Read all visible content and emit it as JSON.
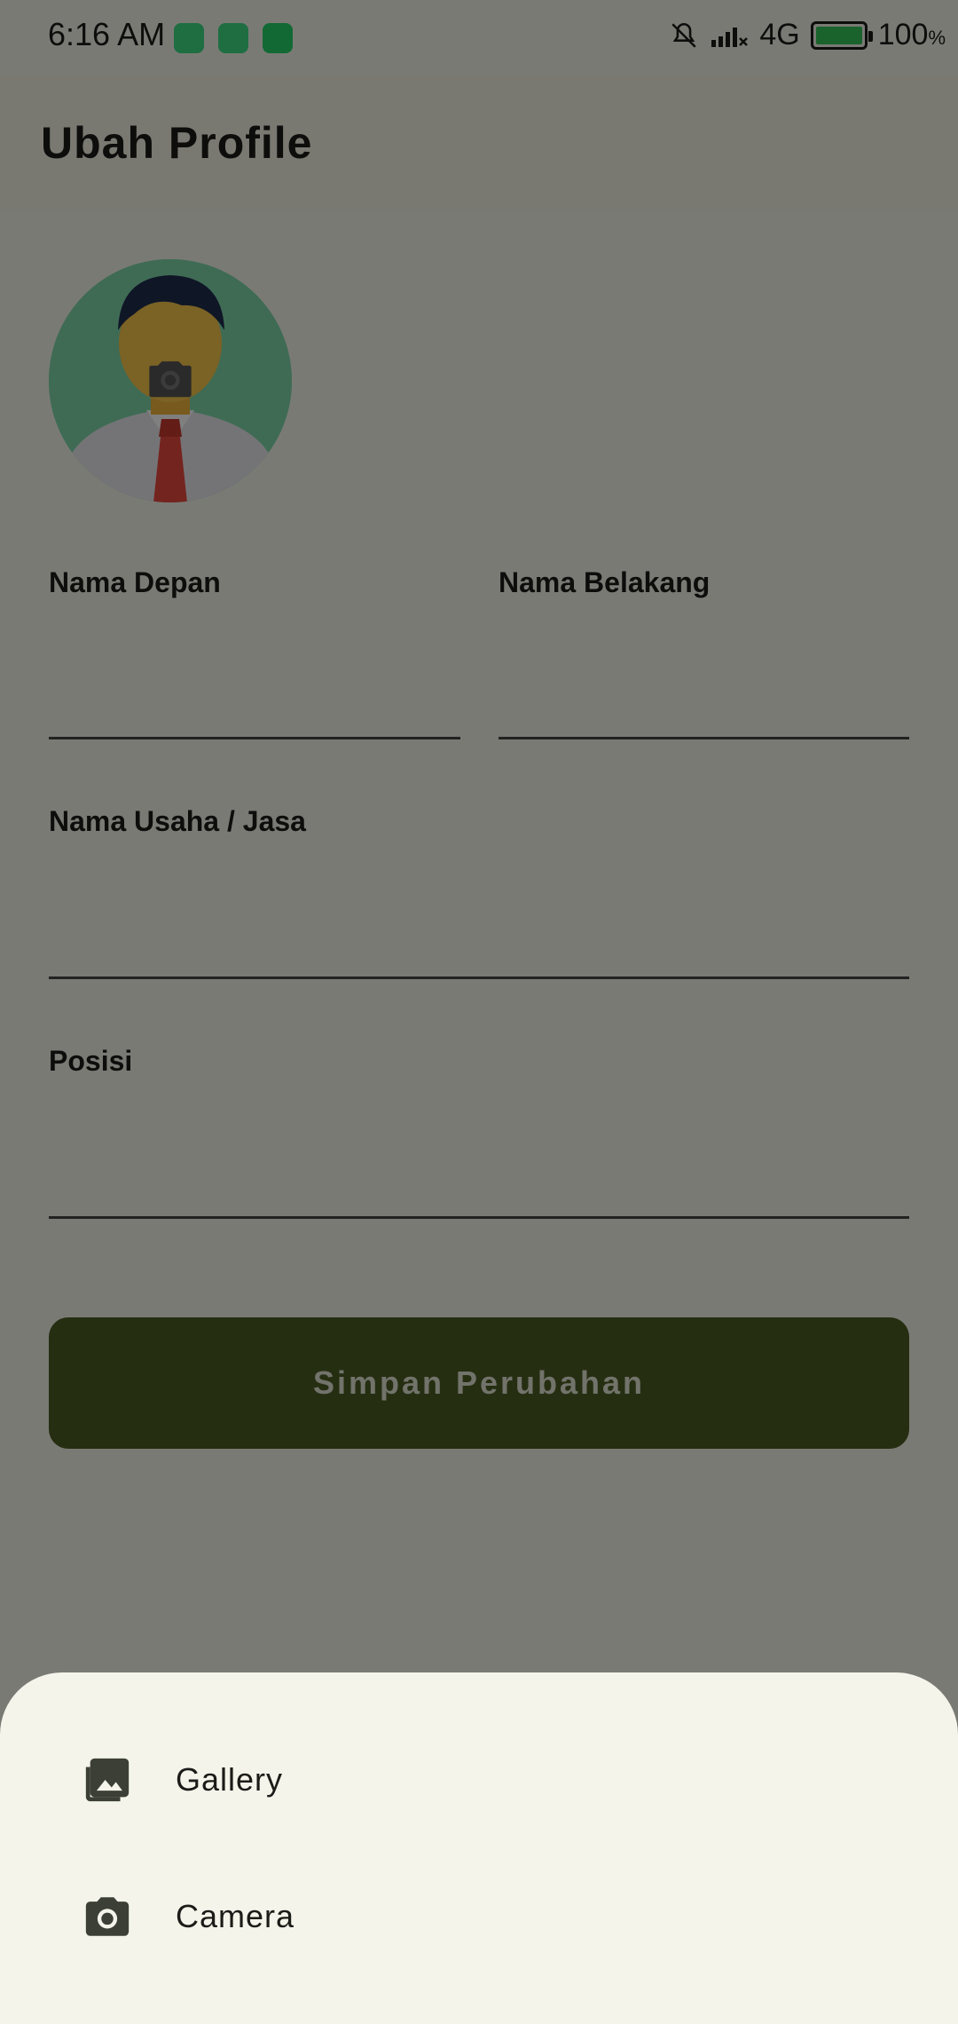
{
  "status_bar": {
    "time": "6:16 AM",
    "network": "4G",
    "battery": "100",
    "battery_unit": "%",
    "notification_icons": [
      "android-app-icon",
      "android-app-icon",
      "whatsapp-icon"
    ]
  },
  "app_bar": {
    "title": "Ubah Profile"
  },
  "form": {
    "first_name_label": "Nama Depan",
    "last_name_label": "Nama Belakang",
    "business_label": "Nama Usaha / Jasa",
    "position_label": "Posisi",
    "save_label": "Simpan Perubahan"
  },
  "bottom_sheet": {
    "items": [
      {
        "label": "Gallery",
        "icon": "gallery-icon"
      },
      {
        "label": "Camera",
        "icon": "camera-icon"
      }
    ]
  },
  "colors": {
    "primary": "#4a5d23",
    "background": "#f4f4ea",
    "scrim": "rgba(0,0,0,0.5)"
  }
}
